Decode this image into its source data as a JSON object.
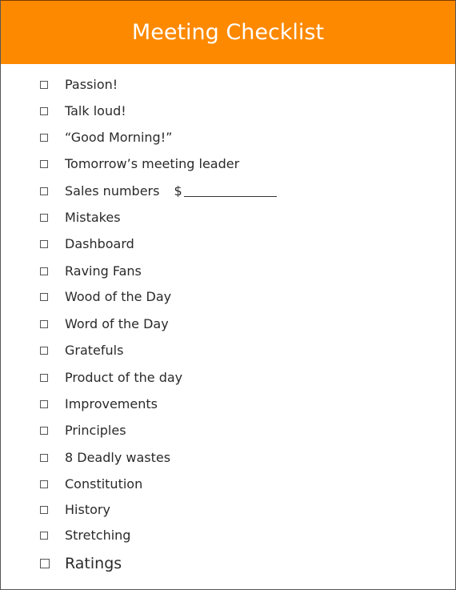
{
  "header": {
    "title": "Meeting Checklist",
    "background_color": "#fd8900"
  },
  "checklist": {
    "items": [
      {
        "label": "Passion!",
        "checked": false
      },
      {
        "label": "Talk loud!",
        "checked": false
      },
      {
        "label": "“Good Morning!”",
        "checked": false
      },
      {
        "label": "Tomorrow’s meeting leader",
        "checked": false
      },
      {
        "label": "Sales numbers",
        "checked": false,
        "suffix": "$"
      },
      {
        "label": "Mistakes",
        "checked": false
      },
      {
        "label": "Dashboard",
        "checked": false
      },
      {
        "label": "Raving Fans",
        "checked": false
      },
      {
        "label": "Wood of the Day",
        "checked": false
      },
      {
        "label": "Word of the Day",
        "checked": false
      },
      {
        "label": "Gratefuls",
        "checked": false
      },
      {
        "label": "Product of the day",
        "checked": false
      },
      {
        "label": "Improvements",
        "checked": false
      },
      {
        "label": "Principles",
        "checked": false
      },
      {
        "label": "8 Deadly wastes",
        "checked": false
      },
      {
        "label": "Constitution",
        "checked": false
      },
      {
        "label": "History",
        "checked": false
      },
      {
        "label": "Stretching",
        "checked": false
      },
      {
        "label": "Ratings",
        "checked": false
      }
    ]
  }
}
